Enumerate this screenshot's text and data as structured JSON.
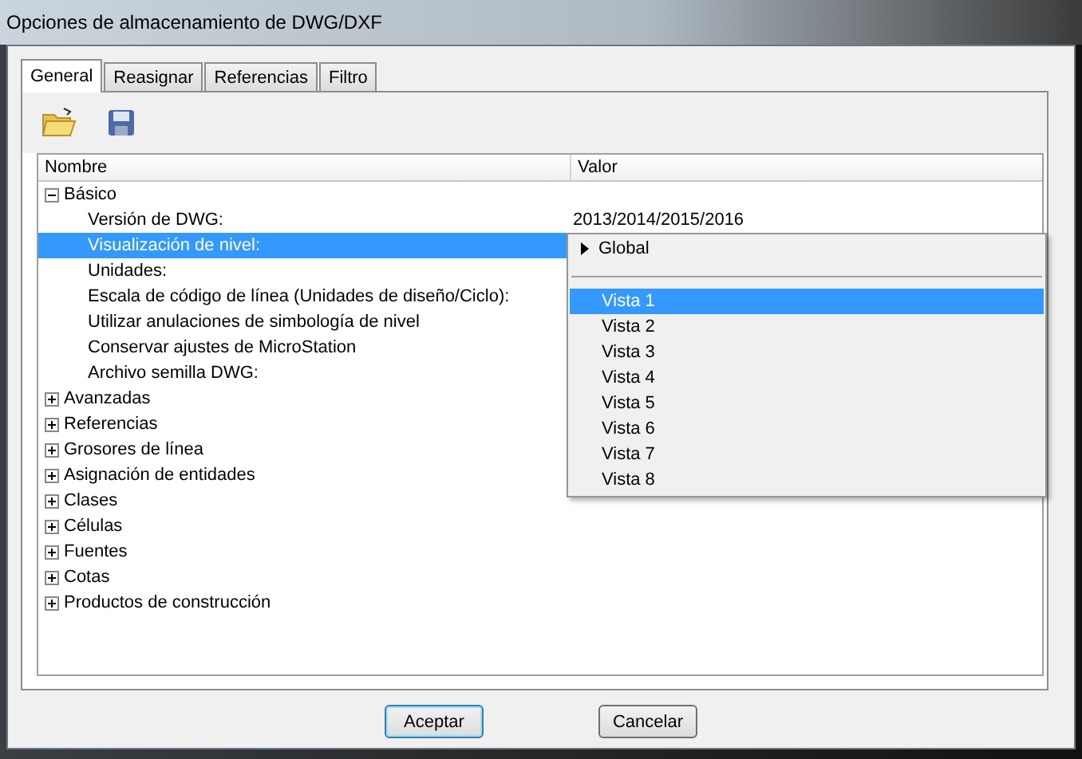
{
  "window": {
    "title": "Opciones de almacenamiento de DWG/DXF"
  },
  "tabs": [
    {
      "label": "General",
      "selected": true
    },
    {
      "label": "Reasignar",
      "selected": false
    },
    {
      "label": "Referencias",
      "selected": false
    },
    {
      "label": "Filtro",
      "selected": false
    }
  ],
  "table": {
    "columns": [
      "Nombre",
      "Valor"
    ],
    "groups": [
      {
        "label": "Básico",
        "expanded": true,
        "children": [
          {
            "name": "Versión de DWG:",
            "value": "2013/2014/2015/2016",
            "selected": false
          },
          {
            "name": "Visualización de nivel:",
            "selected": true
          },
          {
            "name": "Unidades:",
            "selected": false
          },
          {
            "name": "Escala de código de línea (Unidades de diseño/Ciclo):",
            "selected": false
          },
          {
            "name": "Utilizar anulaciones de simbología de nivel",
            "selected": false
          },
          {
            "name": "Conservar ajustes de MicroStation",
            "selected": false
          },
          {
            "name": "Archivo semilla DWG:",
            "selected": false
          }
        ]
      },
      {
        "label": "Avanzadas",
        "expanded": false
      },
      {
        "label": "Referencias",
        "expanded": false
      },
      {
        "label": "Grosores de línea",
        "expanded": false
      },
      {
        "label": "Asignación de entidades",
        "expanded": false
      },
      {
        "label": "Clases",
        "expanded": false
      },
      {
        "label": "Células",
        "expanded": false
      },
      {
        "label": "Fuentes",
        "expanded": false
      },
      {
        "label": "Cotas",
        "expanded": false
      },
      {
        "label": "Productos de construcción",
        "expanded": false
      }
    ]
  },
  "dropdown_menu": {
    "items": [
      {
        "kind": "submenu",
        "label": "Global",
        "selected": false
      },
      {
        "kind": "separator"
      },
      {
        "kind": "item",
        "label": "Vista 1",
        "selected": true
      },
      {
        "kind": "item",
        "label": "Vista 2",
        "selected": false
      },
      {
        "kind": "item",
        "label": "Vista 3",
        "selected": false
      },
      {
        "kind": "item",
        "label": "Vista 4",
        "selected": false
      },
      {
        "kind": "item",
        "label": "Vista 5",
        "selected": false
      },
      {
        "kind": "item",
        "label": "Vista 6",
        "selected": false
      },
      {
        "kind": "item",
        "label": "Vista 7",
        "selected": false
      },
      {
        "kind": "item",
        "label": "Vista 8",
        "selected": false
      }
    ]
  },
  "buttons": [
    {
      "label": "Aceptar",
      "default": true
    },
    {
      "label": "Cancelar",
      "default": false
    }
  ]
}
